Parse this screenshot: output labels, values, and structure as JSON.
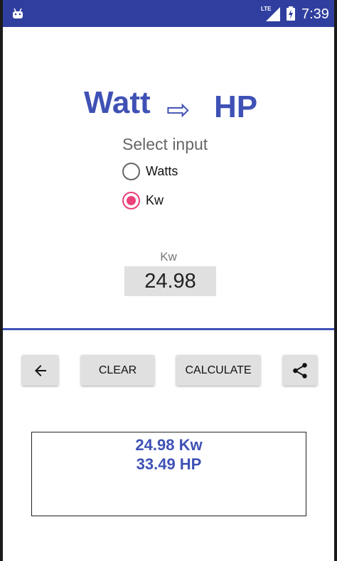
{
  "status_bar": {
    "network": "LTE",
    "time": "7:39",
    "icons": [
      "android-icon",
      "signal-icon",
      "battery-charging-icon"
    ]
  },
  "header": {
    "from_unit": "Watt",
    "arrow": "⇨",
    "to_unit": "HP"
  },
  "input_selector": {
    "label": "Select input",
    "options": [
      {
        "label": "Watts",
        "selected": false
      },
      {
        "label": "Kw",
        "selected": true
      }
    ]
  },
  "input_field": {
    "label": "Kw",
    "value": "24.98"
  },
  "buttons": {
    "back_icon": "arrow-left-icon",
    "clear_label": "CLEAR",
    "calculate_label": "CALCULATE",
    "share_icon": "share-icon"
  },
  "result": {
    "line1": "24.98 Kw",
    "line2": "33.49 HP"
  },
  "colors": {
    "status_bar": "#303f9f",
    "primary": "#3f51b5",
    "accent": "#ec407a"
  }
}
